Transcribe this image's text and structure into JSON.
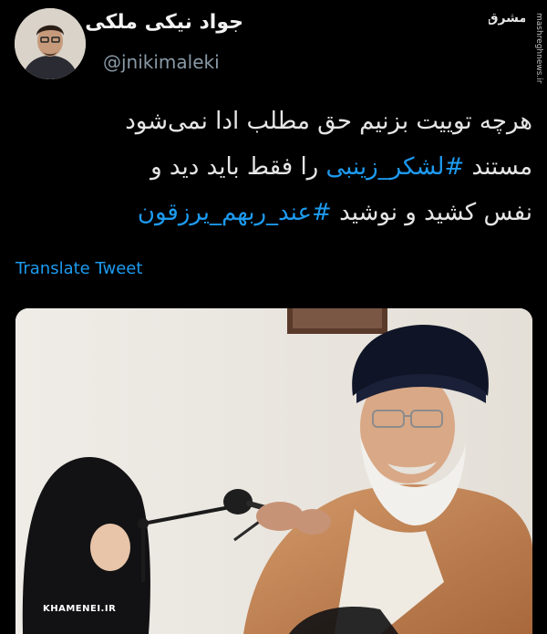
{
  "tweet": {
    "author": {
      "display_name": "جواد نیکی ملکی",
      "handle": "@jnikimaleki",
      "avatar_icon": "profile-photo"
    },
    "text": {
      "line1": "هرچه توییت بزنیم حق مطلب ادا نمی‌شود",
      "line2_prefix": "مستند ",
      "line2_hashtag": "#لشکر_زینبی",
      "line2_suffix": " را فقط باید دید و",
      "line3_prefix": "نفس کشید و نوشید ",
      "line3_hashtag": "#عند_ربهم_یرزقون"
    },
    "translate_label": "Translate Tweet",
    "media": {
      "watermark": "KHAMENEI.IR"
    }
  },
  "source_watermark": {
    "logo_text": "مشرق",
    "url": "mashreghnews.ir"
  },
  "colors": {
    "background": "#000000",
    "link": "#1d9bf0",
    "handle": "#8899a6"
  }
}
